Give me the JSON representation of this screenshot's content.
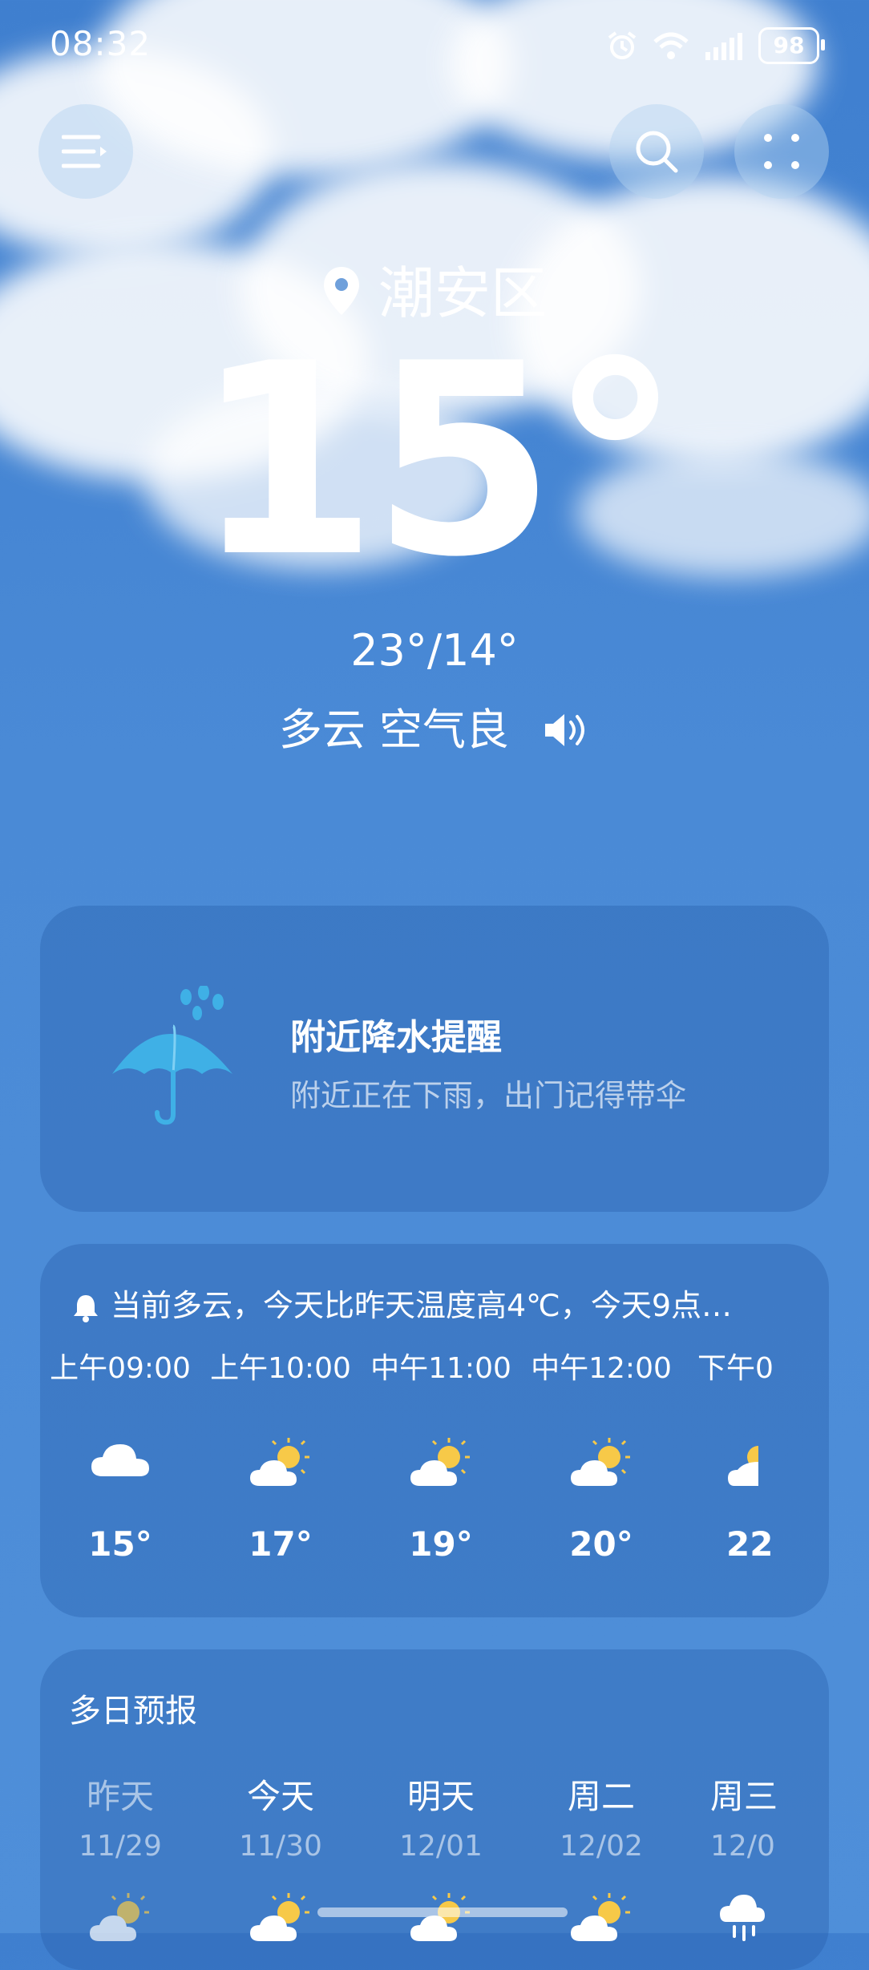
{
  "status_bar": {
    "time": "08:32",
    "battery": "98"
  },
  "header": {
    "location": "潮安区"
  },
  "current": {
    "temp": "15°",
    "hi_lo": "23°/14°",
    "condition": "多云 空气良"
  },
  "alert": {
    "title": "附近降水提醒",
    "subtitle": "附近正在下雨，出门记得带伞"
  },
  "hourly": {
    "summary": "当前多云，今天比昨天温度高4℃，今天9点…",
    "items": [
      {
        "time": "上午09:00",
        "temp": "15°",
        "icon": "cloudy-icon"
      },
      {
        "time": "上午10:00",
        "temp": "17°",
        "icon": "partly-sunny-icon"
      },
      {
        "time": "中午11:00",
        "temp": "19°",
        "icon": "partly-sunny-icon"
      },
      {
        "time": "中午12:00",
        "temp": "20°",
        "icon": "partly-sunny-icon"
      },
      {
        "time": "下午0",
        "temp": "22",
        "icon": "partly-sunny-icon"
      }
    ]
  },
  "daily": {
    "title": "多日预报",
    "items": [
      {
        "day": "昨天",
        "date": "11/29",
        "icon": "partly-sunny-icon"
      },
      {
        "day": "今天",
        "date": "11/30",
        "icon": "partly-sunny-icon"
      },
      {
        "day": "明天",
        "date": "12/01",
        "icon": "partly-sunny-icon"
      },
      {
        "day": "周二",
        "date": "12/02",
        "icon": "partly-sunny-icon"
      },
      {
        "day": "周三",
        "date": "12/0",
        "icon": "rain-icon"
      }
    ]
  },
  "colors": {
    "background": "#4a8ad6",
    "card": "#3a78c4",
    "sun": "#f7c948",
    "umbrella": "#3fb0e6"
  }
}
